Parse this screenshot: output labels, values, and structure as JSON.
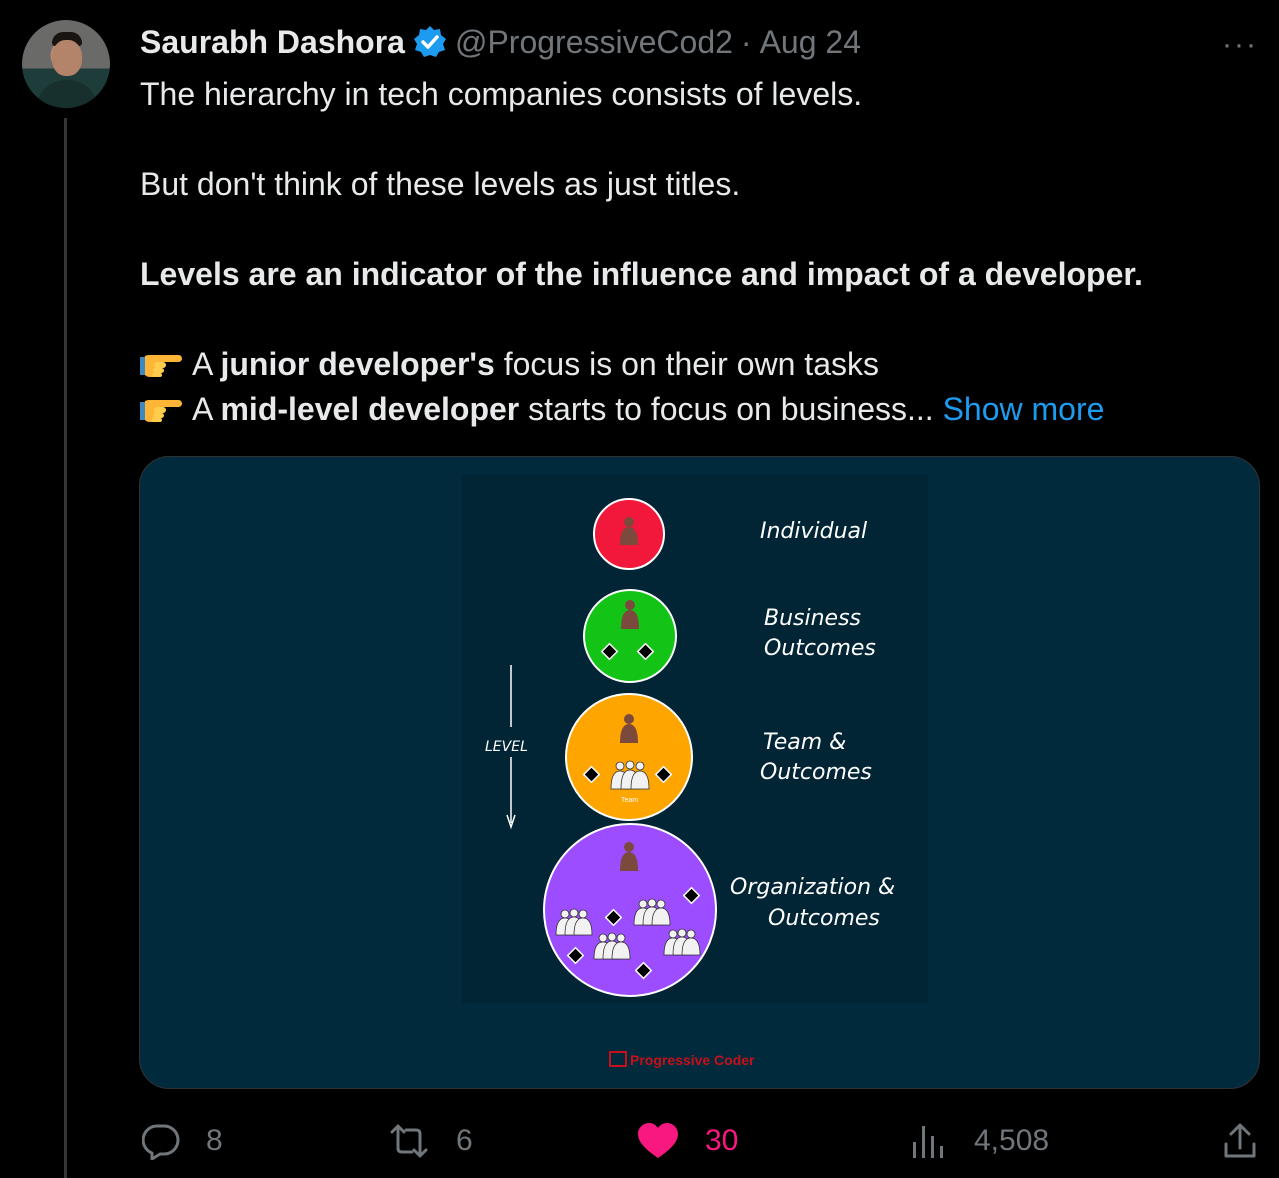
{
  "tweet": {
    "author_name": "Saurabh Dashora",
    "handle": "@ProgressiveCod2",
    "separator": "·",
    "date": "Aug 24",
    "more_menu": "···",
    "line1": "The hierarchy in tech companies consists of levels.",
    "line2": "But don't think of these levels as just titles.",
    "line3": "Levels are an indicator of the influence and impact of a developer.",
    "bullet1_pre": "A ",
    "bullet1_bold": "junior developer's",
    "bullet1_post": " focus is on their own tasks",
    "bullet2_pre": "A ",
    "bullet2_bold": "mid-level developer",
    "bullet2_post": " starts to focus on business...",
    "show_more": "Show more"
  },
  "media": {
    "labels": {
      "individual": "Individual",
      "business_1": "Business",
      "business_2": "Outcomes",
      "team_1": "Team &",
      "team_2": "Outcomes",
      "org_1": "Organization &",
      "org_2": "Outcomes"
    },
    "level_label": "LEVEL",
    "team_tiny": "Team",
    "watermark": "Progressive Coder",
    "colors": {
      "background": "#012b3d",
      "individual": "#f2183b",
      "business": "#13c417",
      "team": "#ffa500",
      "organization": "#9b4dff",
      "person": "#7b4a3c",
      "watermark": "#c8101a"
    }
  },
  "actions": {
    "replies": "8",
    "reposts": "6",
    "likes": "30",
    "views": "4,508"
  },
  "colors": {
    "accent_blue": "#1d9bf0",
    "like_pink": "#f91880",
    "muted": "#71767b"
  }
}
